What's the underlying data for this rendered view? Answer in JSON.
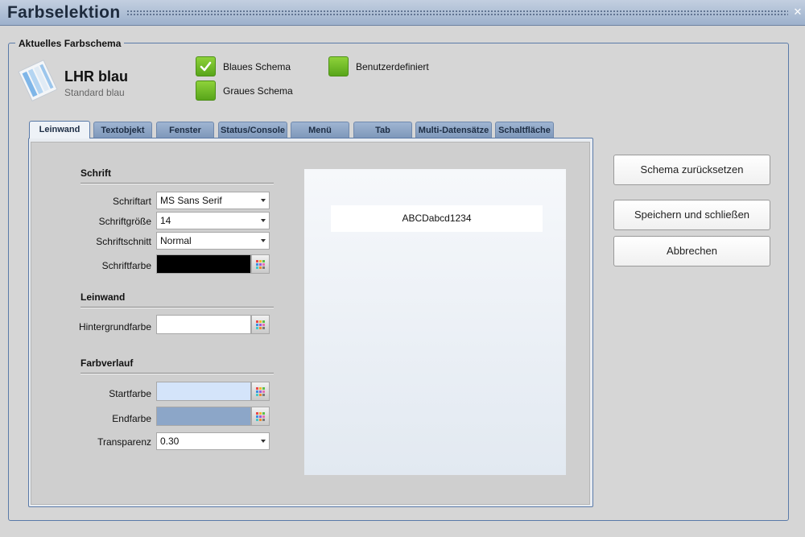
{
  "window": {
    "title": "Farbselektion"
  },
  "group": {
    "legend": "Aktuelles Farbschema"
  },
  "scheme": {
    "name": "LHR blau",
    "subtitle": "Standard blau"
  },
  "options": {
    "blue": {
      "label": "Blaues Schema",
      "checked": true
    },
    "grey": {
      "label": "Graues Schema",
      "checked": false
    },
    "custom": {
      "label": "Benutzerdefiniert",
      "checked": false
    }
  },
  "tabs": [
    "Leinwand",
    "Textobjekt",
    "Fenster",
    "Status/Console",
    "Menü",
    "Tab",
    "Multi-Datensätze",
    "Schaltfläche"
  ],
  "active_tab": "Leinwand",
  "sections": {
    "font": "Schrift",
    "canvas": "Leinwand",
    "gradient": "Farbverlauf"
  },
  "fields": {
    "font_family": {
      "label": "Schriftart",
      "value": "MS Sans Serif"
    },
    "font_size": {
      "label": "Schriftgröße",
      "value": "14"
    },
    "font_style": {
      "label": "Schriftschnitt",
      "value": "Normal"
    },
    "font_color": {
      "label": "Schriftfarbe",
      "color": "#000000"
    },
    "background_color": {
      "label": "Hintergrundfarbe",
      "color": "#ffffff"
    },
    "start_color": {
      "label": "Startfarbe",
      "color": "#d4e4fa"
    },
    "end_color": {
      "label": "Endfarbe",
      "color": "#8ca6c8"
    },
    "transparency": {
      "label": "Transparenz",
      "value": "0.30"
    }
  },
  "preview": {
    "text": "ABCDabcd1234"
  },
  "buttons": {
    "reset": "Schema zurücksetzen",
    "save_close": "Speichern und schließen",
    "cancel": "Abbrechen"
  },
  "colors": {
    "accent_green": "#6cbb25",
    "tab_blue": "#8aa2c2",
    "border_blue": "#5a7aa8"
  }
}
